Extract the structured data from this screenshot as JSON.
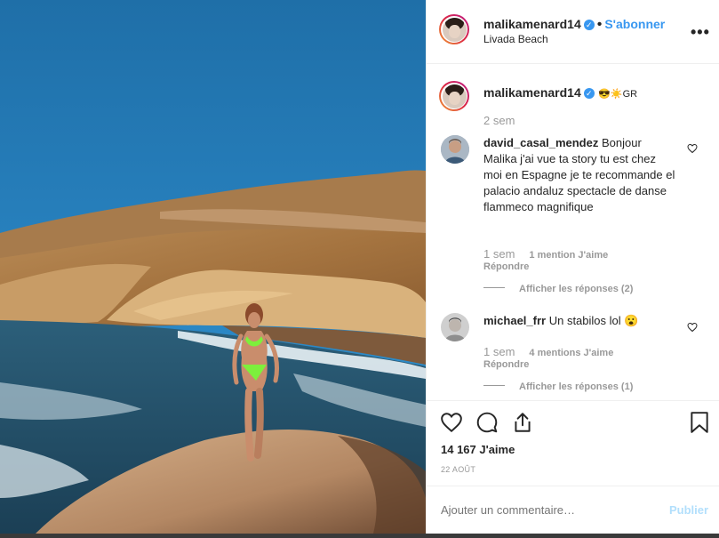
{
  "post": {
    "username": "malikamenard14",
    "verified_glyph": "✓",
    "separator": "•",
    "follow_label": "S'abonner",
    "location": "Livada Beach",
    "more_label": "•••",
    "caption": "😎☀️GR",
    "caption_time": "2 sem"
  },
  "comments": [
    {
      "username": "david_casal_mendez",
      "text": "Bonjour Malika j'ai vue ta story tu est chez moi en Espagne je te recommande el palacio andaluz spectacle de danse flammeco magnifique",
      "time": "1 sem",
      "likes": "1 mention J'aime",
      "reply": "Répondre",
      "view_replies": "Afficher les réponses (2)"
    },
    {
      "username": "michael_frr",
      "text": "Un stabilos lol 😮",
      "time": "1 sem",
      "likes": "4 mentions J'aime",
      "reply": "Répondre",
      "view_replies": "Afficher les réponses (1)"
    }
  ],
  "actions": {
    "likes_count": "14 167 J'aime",
    "date": "22 AOÛT",
    "icons": [
      "heart-icon",
      "comment-icon",
      "share-icon",
      "bookmark-icon"
    ]
  },
  "add_comment": {
    "placeholder": "Ajouter un commentaire…",
    "publish_label": "Publier"
  },
  "colors": {
    "accent": "#3897f0",
    "publish_disabled": "#b2dffc",
    "muted": "#999999",
    "text": "#262626"
  }
}
